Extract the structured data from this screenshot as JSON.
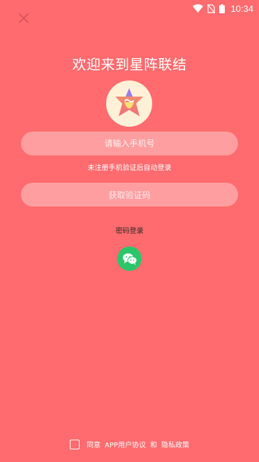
{
  "status_bar": {
    "time": "10:34",
    "icons": [
      "wifi-icon",
      "no-sim-icon",
      "battery-icon"
    ]
  },
  "header": {
    "close_icon": "close-icon"
  },
  "welcome": {
    "title": "欢迎来到星阵联结"
  },
  "login_form": {
    "phone_placeholder": "请输入手机号",
    "phone_value": "",
    "hint": "未注册手机验证后自动登录",
    "get_code_label": "获取验证码",
    "password_login_label": "密码登录",
    "wechat_icon": "wechat-icon"
  },
  "agreement": {
    "agree": "同意",
    "user_agreement": "APP用户协议",
    "and": "和",
    "privacy_policy": "隐私政策",
    "checked": false
  },
  "colors": {
    "background": "#ff6b6e",
    "field": "#ff9da0",
    "wechat": "#2cc66a",
    "logo_bg": "#fff1d8"
  }
}
